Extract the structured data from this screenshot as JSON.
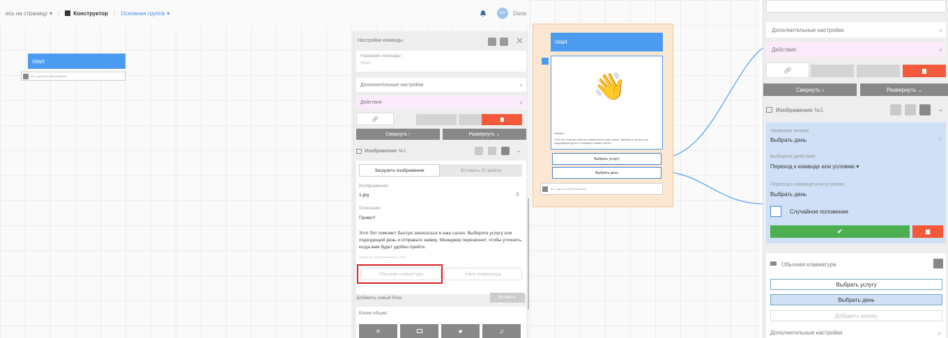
{
  "topbar": {
    "back_label": "ись на страницу",
    "builder_label": "Конструктор",
    "group_label": "Основная группа",
    "user_initials": "DA",
    "user_name": "Daria"
  },
  "left_node": {
    "title": "/start",
    "sub_text": "Бот сделан в @smmplanner"
  },
  "cmd_panel": {
    "title": "Настройки команды",
    "name_label": "Название команды:",
    "name_value": "/start",
    "extra_settings": "Дополнительные настройки",
    "actions": "Действия",
    "collapse": "Свернуть",
    "expand": "Развернуть",
    "image_block_title": "Изображение",
    "image_block_num": "№1",
    "upload_tab": "Загрузить изображение",
    "id_tab": "Вставить ID файла",
    "image_label": "Изображение:",
    "image_file": "1.jpg",
    "desc_label": "Описание:",
    "desc_text_1": "Привет!",
    "desc_text_2": "Этот бот поможет быстро записаться в наш салон. Выберите услугу или подходящий день и отправьте заявку. Менеджер перезвонит, чтобы уточнить, когда вам будет удобно прийти.",
    "desc_counter": "Символов: 190 (максимально: 1024)",
    "kb_normal": "Обычная клавиатура",
    "kb_inline": "Inline клавиатура",
    "add_block": "Добавить новый блок",
    "insert": "Вставить",
    "blocks_common": "Блоки общие:"
  },
  "flow_block": {
    "title": "/start",
    "emoji": "👋",
    "caption_1": "Привет!",
    "caption_2": "Этот бот поможет быстро записаться в наш салон. Выберите услугу или подходящий день и отправьте заявку. Мене...",
    "btn_service": "Выбрать услугу",
    "btn_day": "Выбрать день",
    "footer": "Бот сделан в @smmplanner"
  },
  "right_panel": {
    "extra_settings": "Дополнительные настройки",
    "actions": "Действия",
    "collapse": "Свернуть",
    "expand": "Развернуть",
    "image_title": "Изображение",
    "image_num": "№1",
    "btn_name_label": "Название кнопки:",
    "btn_name_value": "Выбрать день",
    "action_label": "Выберите действие:",
    "action_value": "Переход к команде или условию",
    "goto_label": "Переход к команде или условию:",
    "goto_value": "Выбрать день",
    "random_label": "Случайное положение",
    "kb_title": "Обычная клавиатура",
    "kb_btn_1": "Выбрать услугу",
    "kb_btn_2": "Выбрать день",
    "kb_add": "Добавить кнопку",
    "extra_settings_2": "Дополнительные настройки"
  },
  "colors": {
    "accent": "#4b9cf0",
    "danger": "#f4593b",
    "success": "#4caf50",
    "highlight": "#dc1f26",
    "block_bg": "#fce7d2"
  }
}
